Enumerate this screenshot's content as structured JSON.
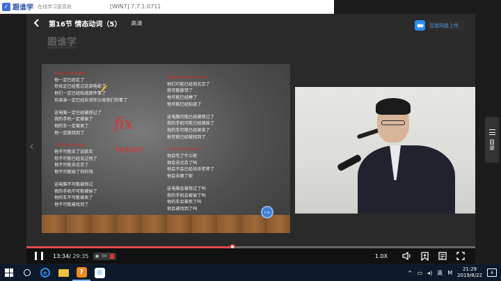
{
  "app": {
    "logo_text": "跟谁学",
    "slogan": "在线学习更高效",
    "window_title": "[WIN7] 7.7.1.0711"
  },
  "player": {
    "lesson_title": "第16节 情态动词（5）",
    "quality": "高清",
    "cloud_upload_label": "百度网盘上传",
    "watermark": "跟谁学",
    "watermark_sub": "genshuixue.com"
  },
  "slide": {
    "left_heading_1": "Must have done",
    "left_lines_1": [
      "他一定已经走了",
      "你肯定已经看过这部电影了",
      "他们一定已经知道那件事了",
      "你弟弟一定已经告诉你父母我们的事了"
    ],
    "left_lines_2": [
      "这电脑一定已经被修过了",
      "我的手机一定被偷了",
      "他的车一定被卖了",
      "他一定被找到了"
    ],
    "left_heading_2": "Can't have done",
    "left_lines_3": [
      "他不可能买了这款车",
      "你不可能已经见过他了",
      "他不可能去北京了",
      "他不可能偷了你的钱"
    ],
    "left_lines_4": [
      "这电脑不可能被修过",
      "我的手机不可能被偷了",
      "他的车不可能被卖了",
      "他不可能被找到了"
    ],
    "right_heading_1": "May/might have done",
    "right_lines_1": [
      "他们可能已经到北京了",
      "我可能做错了",
      "他可能已经睡了",
      "他可能已经知道了"
    ],
    "right_lines_2": [
      "这电脑可能已经被修过了",
      "我的手机可能已经被偷了",
      "他的车可能已经被卖了",
      "他可能已经被找到了"
    ],
    "right_heading_2": "Could have done",
    "right_lines_3": [
      "他会吃了什么呢",
      "他会去北京了吗",
      "他会不会已经告诉老师了",
      "他会去哪了呢"
    ],
    "right_lines_4": [
      "这电脑会被修过了吗",
      "我的手机会被偷了吗",
      "他的车会被卖了吗",
      "他会被找到了吗"
    ],
    "annotation_fix": "fix",
    "annotation_repair": "repair",
    "badge": "1.0x"
  },
  "controls": {
    "current_time": "13:34",
    "separator": "/",
    "total_time": "29:35",
    "progress_fraction": 0.459,
    "speed": "1.0X",
    "mini_toolbar_label": "00"
  },
  "side_panel": {
    "label": "目录"
  },
  "taskbar": {
    "ime_label": "英",
    "input_badge": "M",
    "time": "21:29",
    "date": "2019/8/22",
    "notifications": "4"
  },
  "colors": {
    "accent_red": "#e34a4a",
    "brand_blue": "#2d8cf0",
    "taskbar": "#0e1a2b"
  }
}
